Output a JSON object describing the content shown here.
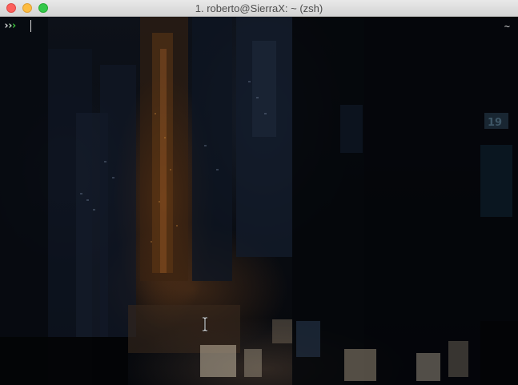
{
  "window": {
    "title": "1. roberto@SierraX: ~ (zsh)",
    "controls": [
      "close",
      "minimize",
      "zoom"
    ]
  },
  "terminal": {
    "prompt_chevrons": [
      "›",
      "›",
      "›"
    ],
    "input": "",
    "cwd": "~",
    "background": "cyberpunk city street wallpaper"
  },
  "colors": {
    "close": "#fc605c",
    "minimize": "#fdbc40",
    "zoom": "#34c84a",
    "prompt_accent": "#3ed13e"
  },
  "icons": [
    "i-beam-cursor-icon"
  ]
}
